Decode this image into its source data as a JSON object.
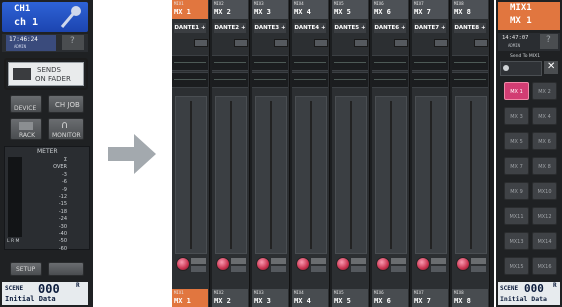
{
  "left_panel": {
    "channel_id": "CH1",
    "channel_name": "ch 1",
    "time": "17:46:24",
    "user": "ADMIN",
    "sends_on_fader_line1": "SENDS",
    "sends_on_fader_line2": "ON FADER",
    "device_label": "DEVICE",
    "ch_job_label": "CH JOB",
    "rack_label": "RACK",
    "monitor_label": "MONITOR",
    "meter_title": "METER",
    "meter_scale": [
      "Σ",
      "OVER",
      "-3",
      "-6",
      "-9",
      "-12",
      "-15",
      "-18",
      "-24",
      "-30",
      "-40",
      "-50",
      "-60"
    ],
    "meter_lrm": "L  R  M",
    "setup_label": "SETUP",
    "scene_label": "SCENE",
    "scene_number": "000",
    "scene_r": "R",
    "scene_name": "Initial Data"
  },
  "channels": [
    {
      "top_small": "MIX1",
      "top_big": "MX 1",
      "patch": "DANTE1 +",
      "bottom_small": "MIX1",
      "bottom_big": "MX 1"
    },
    {
      "top_small": "MIX2",
      "top_big": "MX 2",
      "patch": "DANTE2 +",
      "bottom_small": "MIX2",
      "bottom_big": "MX 2"
    },
    {
      "top_small": "MIX3",
      "top_big": "MX 3",
      "patch": "DANTE3 +",
      "bottom_small": "MIX3",
      "bottom_big": "MX 3"
    },
    {
      "top_small": "MIX4",
      "top_big": "MX 4",
      "patch": "DANTE4 +",
      "bottom_small": "MIX4",
      "bottom_big": "MX 4"
    },
    {
      "top_small": "MIX5",
      "top_big": "MX 5",
      "patch": "DANTE5 +",
      "bottom_small": "MIX5",
      "bottom_big": "MX 5"
    },
    {
      "top_small": "MIX6",
      "top_big": "MX 6",
      "patch": "DANTE6 +",
      "bottom_small": "MIX6",
      "bottom_big": "MX 6"
    },
    {
      "top_small": "MIX7",
      "top_big": "MX 7",
      "patch": "DANTE7 +",
      "bottom_small": "MIX7",
      "bottom_big": "MX 7"
    },
    {
      "top_small": "MIX8",
      "top_big": "MX 8",
      "patch": "DANTE8 +",
      "bottom_small": "MIX8",
      "bottom_big": "MX 8"
    }
  ],
  "right_panel": {
    "mix_id": "MIX1",
    "mix_name": "MX 1",
    "time": "14:47:07",
    "user": "ADMIN",
    "send_to": "Send To MIX1",
    "mix_buttons": [
      "MX 1",
      "MX 2",
      "MX 3",
      "MX 4",
      "MX 5",
      "MX 6",
      "MX 7",
      "MX 8",
      "MX 9",
      "MX10",
      "MX11",
      "MX12",
      "MX13",
      "MX14",
      "MX15",
      "MX16"
    ],
    "scene_label": "SCENE",
    "scene_number": "000",
    "scene_r": "R",
    "scene_name": "Initial Data"
  },
  "colors": {
    "accent_blue": "#2e63d6",
    "selected_orange": "#e1763f",
    "send_pink": "#d23d73",
    "arrow_gray": "#a3a9ae"
  }
}
